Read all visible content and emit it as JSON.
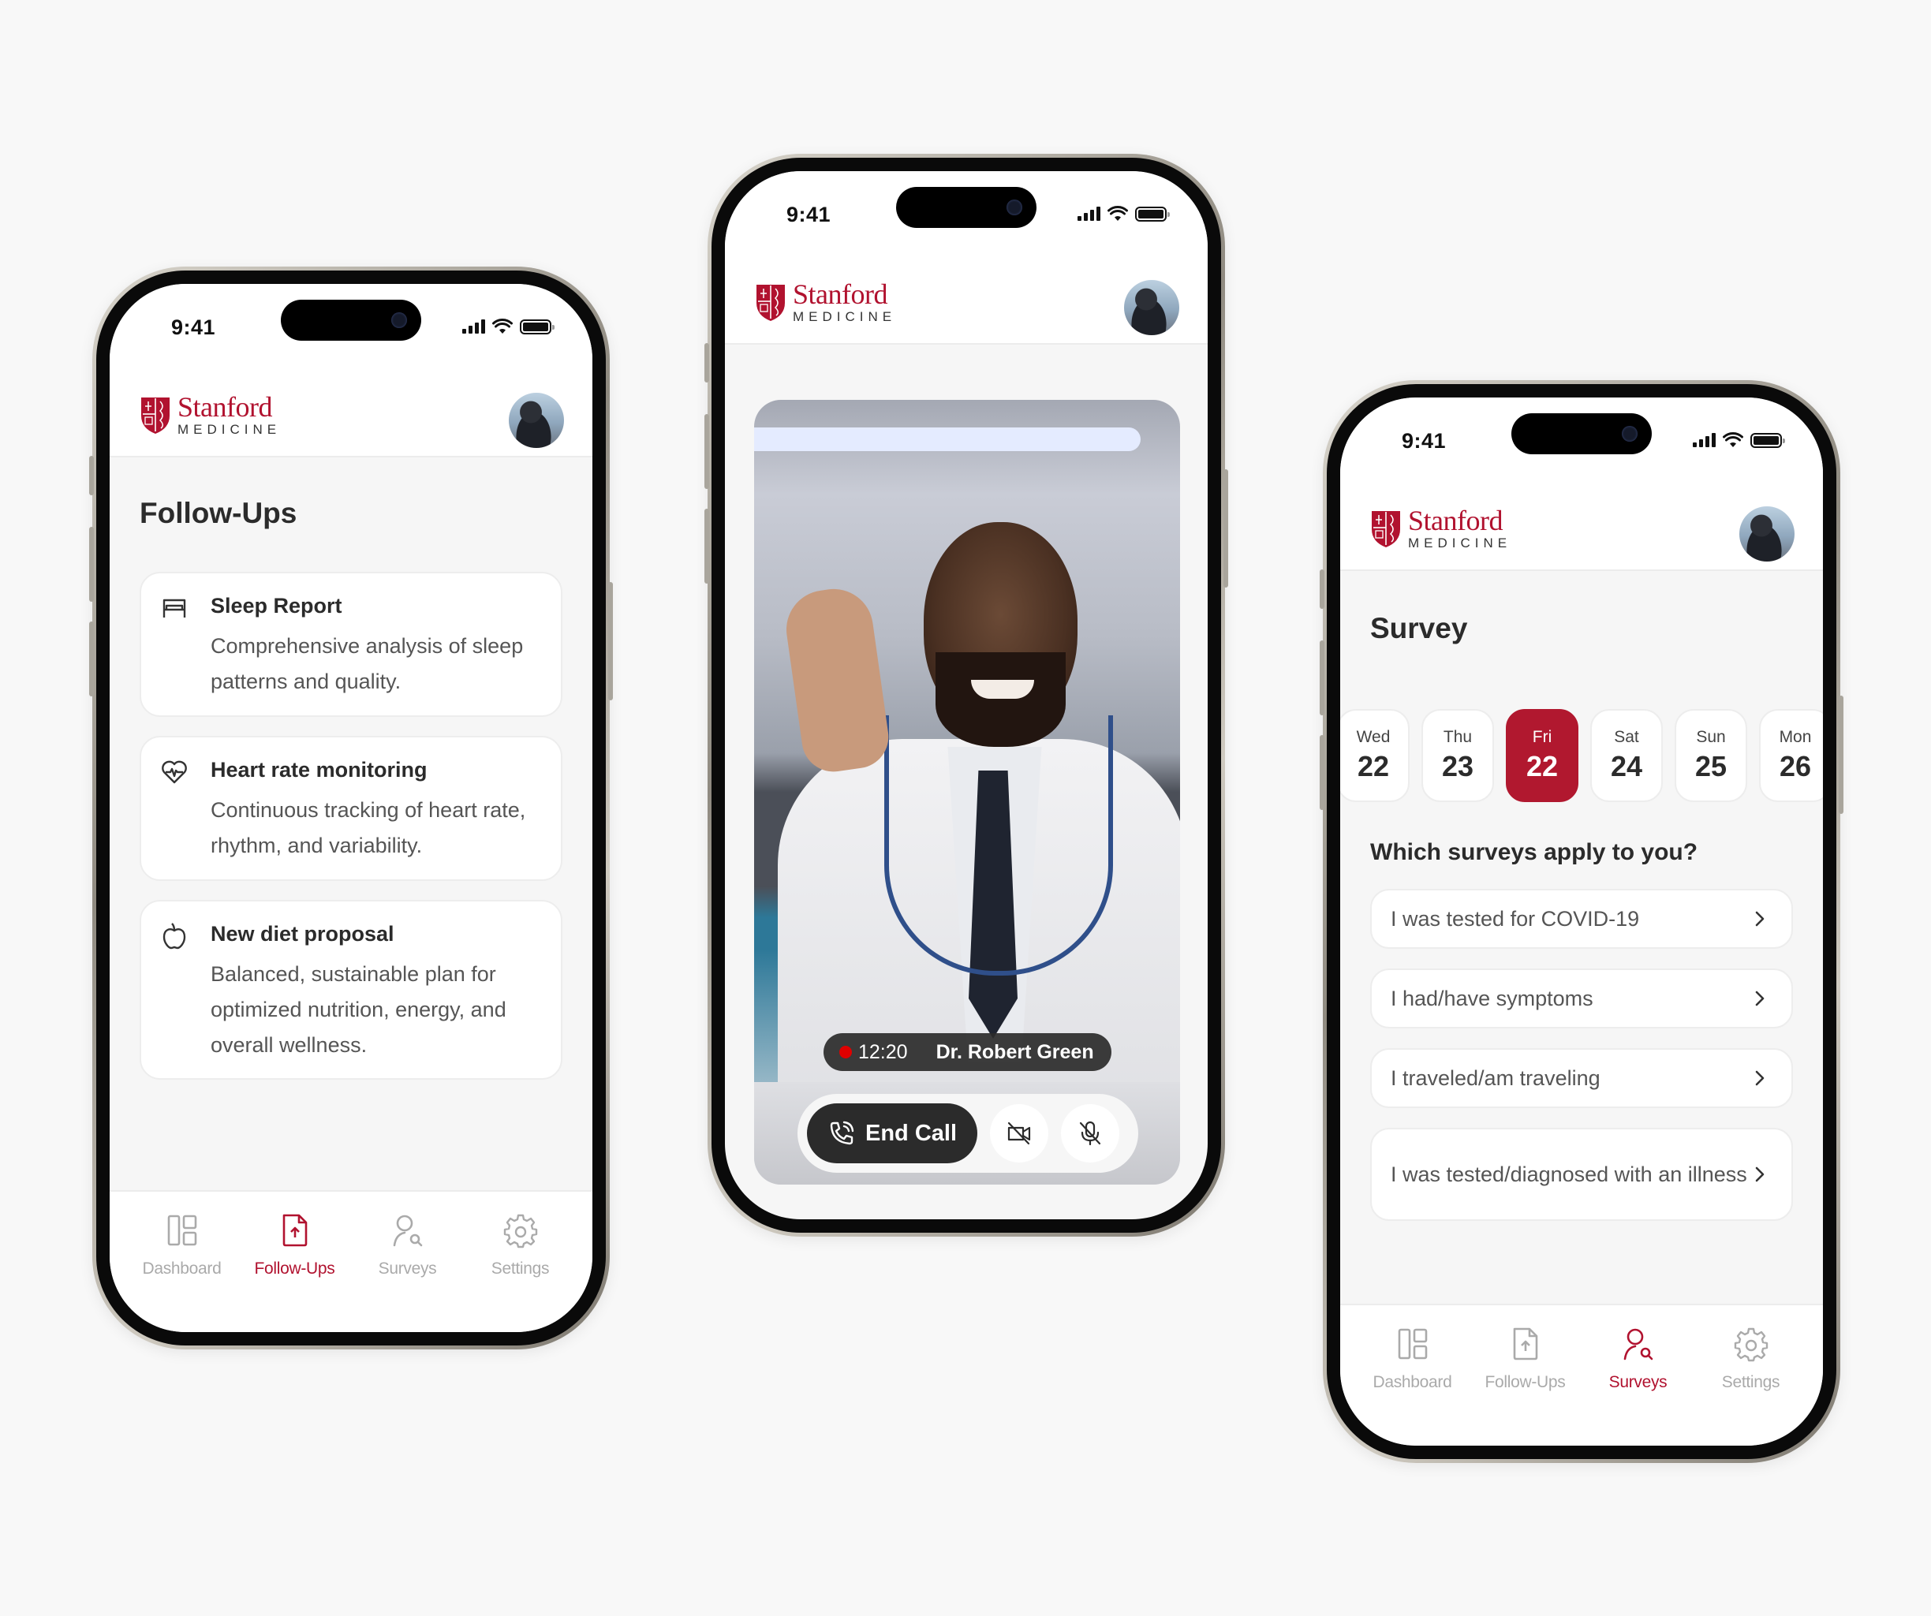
{
  "brand": {
    "name": "Stanford",
    "subname": "MEDICINE",
    "accent": "#b1122f"
  },
  "status_bar": {
    "time": "9:41",
    "icons": [
      "cellular-signal-icon",
      "wifi-icon",
      "battery-icon"
    ]
  },
  "phones": {
    "followups": {
      "title": "Follow-Ups",
      "cards": [
        {
          "icon": "bed-icon",
          "title": "Sleep Report",
          "description": "Comprehensive analysis of sleep patterns and quality."
        },
        {
          "icon": "heart-pulse-icon",
          "title": "Heart rate monitoring",
          "description": "Continuous tracking of heart rate, rhythm, and variability."
        },
        {
          "icon": "apple-icon",
          "title": "New diet proposal",
          "description": "Balanced, sustainable plan for optimized nutrition, energy, and overall wellness."
        }
      ],
      "active_tab": "Follow-Ups"
    },
    "video_call": {
      "recording": true,
      "elapsed": "12:20",
      "doctor_name": "Dr. Robert Green",
      "end_call_label": "End Call",
      "controls": [
        "camera-off-icon",
        "mic-off-icon"
      ]
    },
    "survey": {
      "title": "Survey",
      "dates": [
        {
          "dow": "Wed",
          "day": "22",
          "selected": false
        },
        {
          "dow": "Thu",
          "day": "23",
          "selected": false
        },
        {
          "dow": "Fri",
          "day": "22",
          "selected": true
        },
        {
          "dow": "Sat",
          "day": "24",
          "selected": false
        },
        {
          "dow": "Sun",
          "day": "25",
          "selected": false
        },
        {
          "dow": "Mon",
          "day": "26",
          "selected": false
        }
      ],
      "question": "Which surveys apply to you?",
      "options": [
        "I was tested for COVID-19",
        "I had/have symptoms",
        "I traveled/am traveling",
        "I was tested/diagnosed with an illness"
      ],
      "active_tab": "Surveys"
    }
  },
  "tabbar": {
    "items": [
      {
        "label": "Dashboard",
        "icon": "dashboard-icon"
      },
      {
        "label": "Follow-Ups",
        "icon": "file-upload-icon"
      },
      {
        "label": "Surveys",
        "icon": "user-search-icon"
      },
      {
        "label": "Settings",
        "icon": "gear-icon"
      }
    ],
    "active_color": "#b1122f",
    "inactive_color": "#aaaaaa"
  }
}
